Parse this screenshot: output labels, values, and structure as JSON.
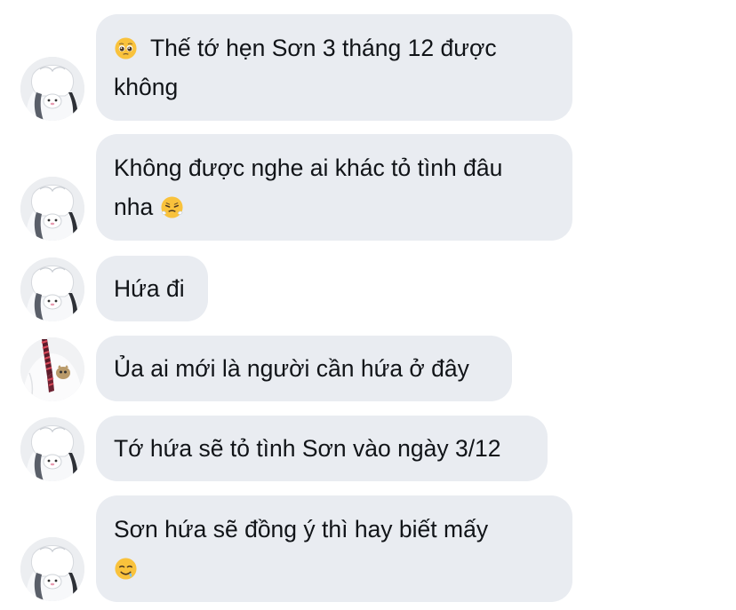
{
  "messages": [
    {
      "sender": "friend",
      "avatar": "girl-avatar",
      "lines": [
        "Thế tớ hẹn Sơn 3 tháng 12 được",
        "không"
      ],
      "lead_emoji": "pleading-face-icon"
    },
    {
      "sender": "friend",
      "avatar": "girl-avatar",
      "lines": [
        "Không được nghe ai khác tỏ tình đâu",
        "nha"
      ],
      "trail_emoji": "steam-nose-face-icon"
    },
    {
      "sender": "friend",
      "avatar": "girl-avatar",
      "lines": [
        "Hứa đi"
      ]
    },
    {
      "sender": "son",
      "avatar": "boy-avatar",
      "lines": [
        "Ủa ai mới là người cần hứa ở đây"
      ]
    },
    {
      "sender": "friend",
      "avatar": "girl-avatar",
      "lines": [
        "Tớ hứa sẽ tỏ tình Sơn vào ngày 3/12"
      ]
    },
    {
      "sender": "friend",
      "avatar": "girl-avatar",
      "lines": [
        "Sơn hứa sẽ đồng ý thì hay biết mấy",
        ""
      ],
      "trail_emoji": "drooling-face-icon"
    }
  ],
  "colors": {
    "bubble": "#e9ecf1",
    "text": "#111418",
    "emoji_yellow": "#f9c23c"
  }
}
